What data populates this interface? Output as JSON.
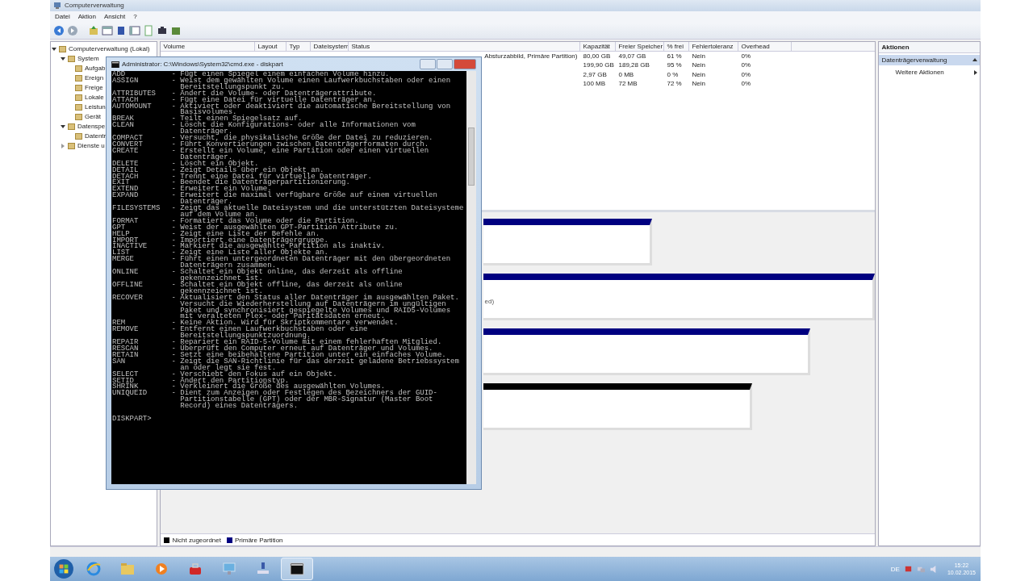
{
  "window": {
    "title": "Computerverwaltung"
  },
  "menu": [
    "Datei",
    "Aktion",
    "Ansicht",
    "?"
  ],
  "tree": [
    {
      "label": "Computerverwaltung (Lokal)",
      "expanded": true,
      "children": [
        {
          "label": "System",
          "expanded": true,
          "children": [
            {
              "label": "Aufgab"
            },
            {
              "label": "Ereign"
            },
            {
              "label": "Freige"
            },
            {
              "label": "Lokale"
            },
            {
              "label": "Leistun"
            },
            {
              "label": "Gerät"
            }
          ]
        },
        {
          "label": "Datenspe",
          "expanded": true,
          "children": [
            {
              "label": "Datentr"
            }
          ]
        },
        {
          "label": "Dienste u",
          "expanded": false
        }
      ]
    }
  ],
  "table": {
    "columns": [
      "Volume",
      "Layout",
      "Typ",
      "Dateisystem",
      "Status",
      "Kapazität",
      "Freier Speicher",
      "% frei",
      "Fehlertoleranz",
      "Overhead"
    ],
    "rows": [
      {
        "status": "Absturzabbild, Primäre Partition)",
        "capacity": "80,00 GB",
        "free": "49,07 GB",
        "percent": "61 %",
        "fault": "Nein",
        "overhead": "0%"
      },
      {
        "status": "",
        "capacity": "199,90 GB",
        "free": "189,28 GB",
        "percent": "95 %",
        "fault": "Nein",
        "overhead": "0%"
      },
      {
        "status": "",
        "capacity": "2,97 GB",
        "free": "0 MB",
        "percent": "0 %",
        "fault": "Nein",
        "overhead": "0%"
      },
      {
        "status": "",
        "capacity": "100 MB",
        "free": "72 MB",
        "percent": "72 %",
        "fault": "Nein",
        "overhead": "0%"
      }
    ]
  },
  "disks": [
    {
      "kind": "primary"
    },
    {
      "kind": "primary",
      "text": "ed)"
    },
    {
      "kind": "primary"
    },
    {
      "kind": "unallocated"
    }
  ],
  "legend": [
    {
      "kind": "unallocated",
      "label": "Nicht zugeordnet"
    },
    {
      "kind": "primary",
      "label": "Primäre Partition"
    }
  ],
  "actions": [
    {
      "kind": "header",
      "label": "Aktionen"
    },
    {
      "kind": "section",
      "label": "Datenträgerverwaltung"
    },
    {
      "kind": "item",
      "label": "Weitere Aktionen"
    }
  ],
  "console": {
    "title": "Administrator: C:\\Windows\\System32\\cmd.exe - diskpart",
    "commands": [
      {
        "name": "ADD",
        "text": "- Fügt einen Spiegel einem einfachen Volume hinzu."
      },
      {
        "name": "ASSIGN",
        "text": "- Weist dem gewählten Volume einen Laufwerkbuchstaben oder einen Bereitstellungspunkt zu."
      },
      {
        "name": "ATTRIBUTES",
        "text": "- Ändert die Volume- oder Datenträgerattribute."
      },
      {
        "name": "ATTACH",
        "text": "- Fügt eine Datei für virtuelle Datenträger an."
      },
      {
        "name": "AUTOMOUNT",
        "text": "- Aktiviert oder deaktiviert die automatische Bereitstellung von Basisvolumes."
      },
      {
        "name": "BREAK",
        "text": "- Teilt einen Spiegelsatz auf."
      },
      {
        "name": "CLEAN",
        "text": "- Löscht die Konfigurations- oder alle Informationen vom Datenträger."
      },
      {
        "name": "COMPACT",
        "text": "- Versucht, die physikalische Größe der Datei zu reduzieren."
      },
      {
        "name": "CONVERT",
        "text": "- Führt Konvertierungen zwischen Datenträgerformaten durch."
      },
      {
        "name": "CREATE",
        "text": "- Erstellt ein Volume, eine Partition oder einen virtuellen Datenträger."
      },
      {
        "name": "DELETE",
        "text": "- Löscht ein Objekt."
      },
      {
        "name": "DETAIL",
        "text": "- Zeigt Details über ein Objekt an."
      },
      {
        "name": "DETACH",
        "text": "- Trennt eine Datei für virtuelle Datenträger."
      },
      {
        "name": "EXIT",
        "text": "- Beendet die Datenträgerpartitionierung."
      },
      {
        "name": "EXTEND",
        "text": "- Erweitert ein Volume."
      },
      {
        "name": "EXPAND",
        "text": "- Erweitert die maximal verfügbare Größe auf einem virtuellen Datenträger."
      },
      {
        "name": "FILESYSTEMS",
        "text": "- Zeigt das aktuelle Dateisystem und die unterstützten Dateisysteme auf dem Volume an."
      },
      {
        "name": "FORMAT",
        "text": "- Formatiert das Volume oder die Partition."
      },
      {
        "name": "GPT",
        "text": "- Weist der ausgewählten GPT-Partition Attribute zu."
      },
      {
        "name": "HELP",
        "text": "- Zeigt eine Liste der Befehle an."
      },
      {
        "name": "IMPORT",
        "text": "- Importiert eine Datenträgergruppe."
      },
      {
        "name": "INACTIVE",
        "text": "- Markiert die ausgewählte Partition als inaktiv."
      },
      {
        "name": "LIST",
        "text": "- Zeigt eine Liste aller Objekte an."
      },
      {
        "name": "MERGE",
        "text": "- Führt einen untergeordneten Datenträger mit den übergeordneten Datenträgern zusammen."
      },
      {
        "name": "ONLINE",
        "text": "- Schaltet ein Objekt online, das derzeit als offline gekennzeichnet ist."
      },
      {
        "name": "OFFLINE",
        "text": "- Schaltet ein Objekt offline, das derzeit als online gekennzeichnet ist."
      },
      {
        "name": "RECOVER",
        "text": "- Aktualisiert den Status aller Datenträger im ausgewählten Paket. Versucht die Wiederherstellung auf Datenträgern im ungültigen Paket und synchronisiert gespiegelte Volumes und RAID5-Volumes mit veralteten Plex- oder Paritätsdaten erneut."
      },
      {
        "name": "REM",
        "text": "- Keine Aktion. Wird für Skriptkommentare verwendet."
      },
      {
        "name": "REMOVE",
        "text": "- Entfernt einen Laufwerkbuchstaben oder eine Bereitstellungspunktzuordnung."
      },
      {
        "name": "REPAIR",
        "text": "- Repariert ein RAID-5-Volume mit einem fehlerhaften Mitglied."
      },
      {
        "name": "RESCAN",
        "text": "- Überprüft den Computer erneut auf Datenträger und Volumes."
      },
      {
        "name": "RETAIN",
        "text": "- Setzt eine beibehaltene Partition unter ein einfaches Volume."
      },
      {
        "name": "SAN",
        "text": "- Zeigt die SAN-Richtlinie für das derzeit geladene Betriebssystem an oder legt sie fest."
      },
      {
        "name": "SELECT",
        "text": "- Verschiebt den Fokus auf ein Objekt."
      },
      {
        "name": "SETID",
        "text": "- Ändert den Partitionstyp."
      },
      {
        "name": "SHRINK",
        "text": "- Verkleinert die Größe des ausgewählten Volumes."
      },
      {
        "name": "UNIQUEID",
        "text": "- Dient zum Anzeigen oder Festlegen des Bezeichners der GUID-Partitionstabelle (GPT) oder der MBR-Signatur (Master Boot Record) eines Datenträgers."
      }
    ],
    "prompt": "DISKPART>"
  },
  "taskbar": {
    "apps": [
      {
        "kind": "ie",
        "selected": false
      },
      {
        "kind": "explorer",
        "selected": false
      },
      {
        "kind": "media",
        "selected": false
      },
      {
        "kind": "toolbox",
        "selected": false
      },
      {
        "kind": "monitor",
        "selected": false
      },
      {
        "kind": "network",
        "selected": false
      },
      {
        "kind": "console",
        "selected": true
      }
    ],
    "language": "DE",
    "time": "15:22",
    "date": "10.02.2015"
  }
}
